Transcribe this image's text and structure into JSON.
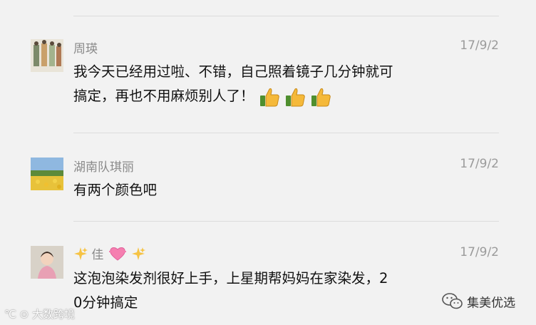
{
  "comments": [
    {
      "author": "周瑛",
      "date": "17/9/2",
      "line1": "我今天已经用过啦、不错，自己照着镜子几分钟就可",
      "line2": "搞定，再也不用麻烦别人了！",
      "emoji": [
        "thumbs-up",
        "thumbs-up",
        "thumbs-up"
      ]
    },
    {
      "author": "湖南队琪丽",
      "date": "17/9/2",
      "line1": "有两个颜色吧"
    },
    {
      "author_text": "佳",
      "date": "17/9/2",
      "line1": "这泡泡染发剂很好上手，上星期帮妈妈在家染发，2",
      "line2": "0分钟搞定"
    }
  ],
  "watermarks": {
    "left": "大数跨境",
    "right": "集美优选"
  },
  "colors": {
    "background": "#f2f2f2",
    "name": "#8a8a8a",
    "thumb": "#f5b93a"
  }
}
